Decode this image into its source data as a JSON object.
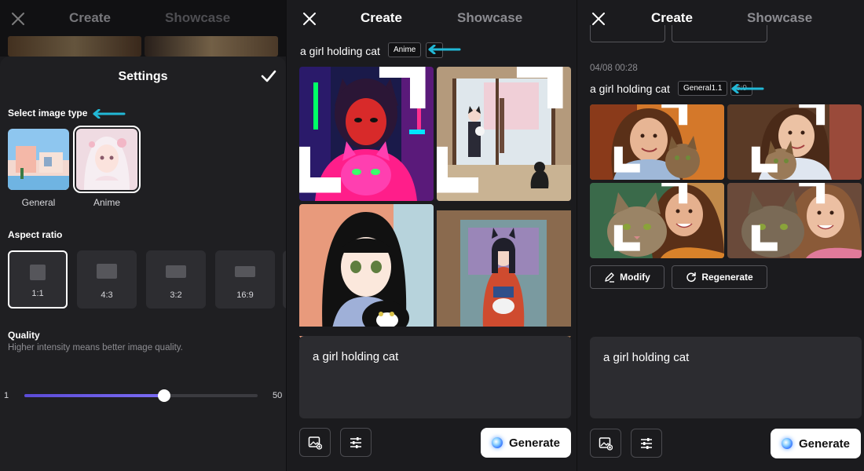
{
  "settings_panel": {
    "tabs": {
      "create": "Create",
      "showcase": "Showcase"
    },
    "title": "Settings",
    "image_type_label": "Select image type",
    "image_types": [
      {
        "label": "General",
        "selected": false
      },
      {
        "label": "Anime",
        "selected": true
      }
    ],
    "aspect_ratio_label": "Aspect ratio",
    "aspect_ratios": [
      {
        "label": "1:1",
        "selected": true
      },
      {
        "label": "4:3",
        "selected": false
      },
      {
        "label": "3:2",
        "selected": false
      },
      {
        "label": "16:9",
        "selected": false
      }
    ],
    "quality_label": "Quality",
    "quality_hint": "Higher intensity means better image quality.",
    "quality_min": "1",
    "quality_max": "50",
    "quality_fraction": 0.6
  },
  "anime_panel": {
    "tabs": {
      "create": "Create",
      "showcase": "Showcase"
    },
    "prompt": "a girl holding cat",
    "tag": "Anime",
    "input_text": "a girl holding cat",
    "generate_label": "Generate"
  },
  "general_panel": {
    "tabs": {
      "create": "Create",
      "showcase": "Showcase"
    },
    "date": "04/08 00:28",
    "prompt": "a girl holding cat",
    "tag": "General1.1",
    "tag_peek": "6:9",
    "modify_label": "Modify",
    "regenerate_label": "Regenerate",
    "input_text": "a girl holding cat",
    "generate_label": "Generate"
  },
  "colors": {
    "accent_arrow": "#22b8d6",
    "slider_fill": "#6b5ce7",
    "background": "#1b1b1e"
  },
  "icons": [
    "close-icon",
    "checkmark-icon",
    "arrow-left-icon",
    "expand-icon",
    "edit-icon",
    "refresh-icon",
    "image-add-icon",
    "sliders-icon",
    "sparkle-orb-icon"
  ]
}
